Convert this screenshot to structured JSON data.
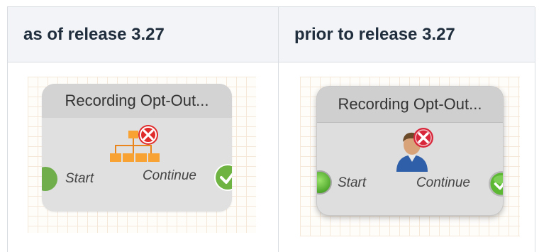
{
  "table": {
    "col1_header": "as of release 3.27",
    "col2_header": "prior to release 3.27"
  },
  "new_node": {
    "title": "Recording Opt-Out...",
    "start_label": "Start",
    "continue_label": "Continue",
    "icon": "hierarchy-with-red-x-icon",
    "start_color": "#6fae4b",
    "title_bg": "#d3d3d3"
  },
  "old_node": {
    "title": "Recording Opt-Out...",
    "start_label": "Start",
    "continue_label": "Continue",
    "icon": "user-with-red-x-icon",
    "start_color": "#4ea72c",
    "title_bg": "#cfcfcf"
  }
}
